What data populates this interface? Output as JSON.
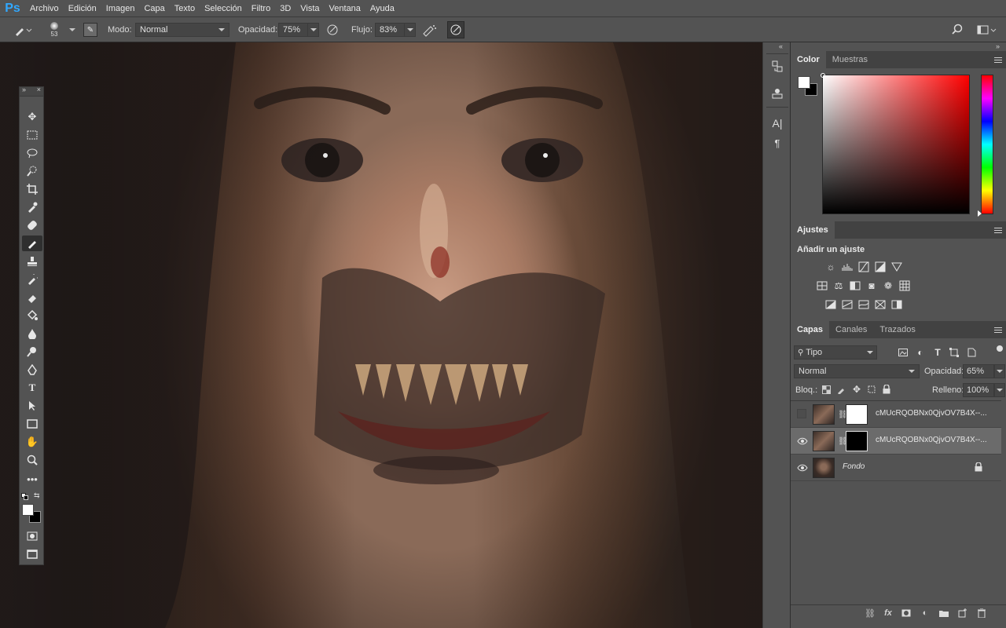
{
  "app": {
    "logo": "Ps"
  },
  "menu": [
    "Archivo",
    "Edición",
    "Imagen",
    "Capa",
    "Texto",
    "Selección",
    "Filtro",
    "3D",
    "Vista",
    "Ventana",
    "Ayuda"
  ],
  "options": {
    "brush_size": "53",
    "mode_label": "Modo:",
    "mode_value": "Normal",
    "opacity_label": "Opacidad:",
    "opacity_value": "75%",
    "flow_label": "Flujo:",
    "flow_value": "83%"
  },
  "color_panel": {
    "tabs": [
      "Color",
      "Muestras"
    ],
    "foreground": "#ffffff",
    "background": "#000000",
    "hue": "#ff0000"
  },
  "adjustments_panel": {
    "tab": "Ajustes",
    "heading": "Añadir un ajuste"
  },
  "layers_panel": {
    "tabs": [
      "Capas",
      "Canales",
      "Trazados"
    ],
    "filter_value": "Tipo",
    "blend_mode": "Normal",
    "opacity_label": "Opacidad:",
    "opacity_value": "65%",
    "lock_label": "Bloq.:",
    "fill_label": "Relleno:",
    "fill_value": "100%",
    "layers": [
      {
        "name": "cMUcRQOBNx0QjvOV7B4X--...",
        "visible": false,
        "selected": false,
        "mask": "#ffffff"
      },
      {
        "name": "cMUcRQOBNx0QjvOV7B4X--...",
        "visible": true,
        "selected": true,
        "mask": "#000000"
      },
      {
        "name": "Fondo",
        "visible": true,
        "selected": false,
        "mask": ""
      }
    ]
  },
  "icons": {
    "eye": "eye-icon",
    "lock": "lock-icon",
    "search": "search-icon"
  }
}
